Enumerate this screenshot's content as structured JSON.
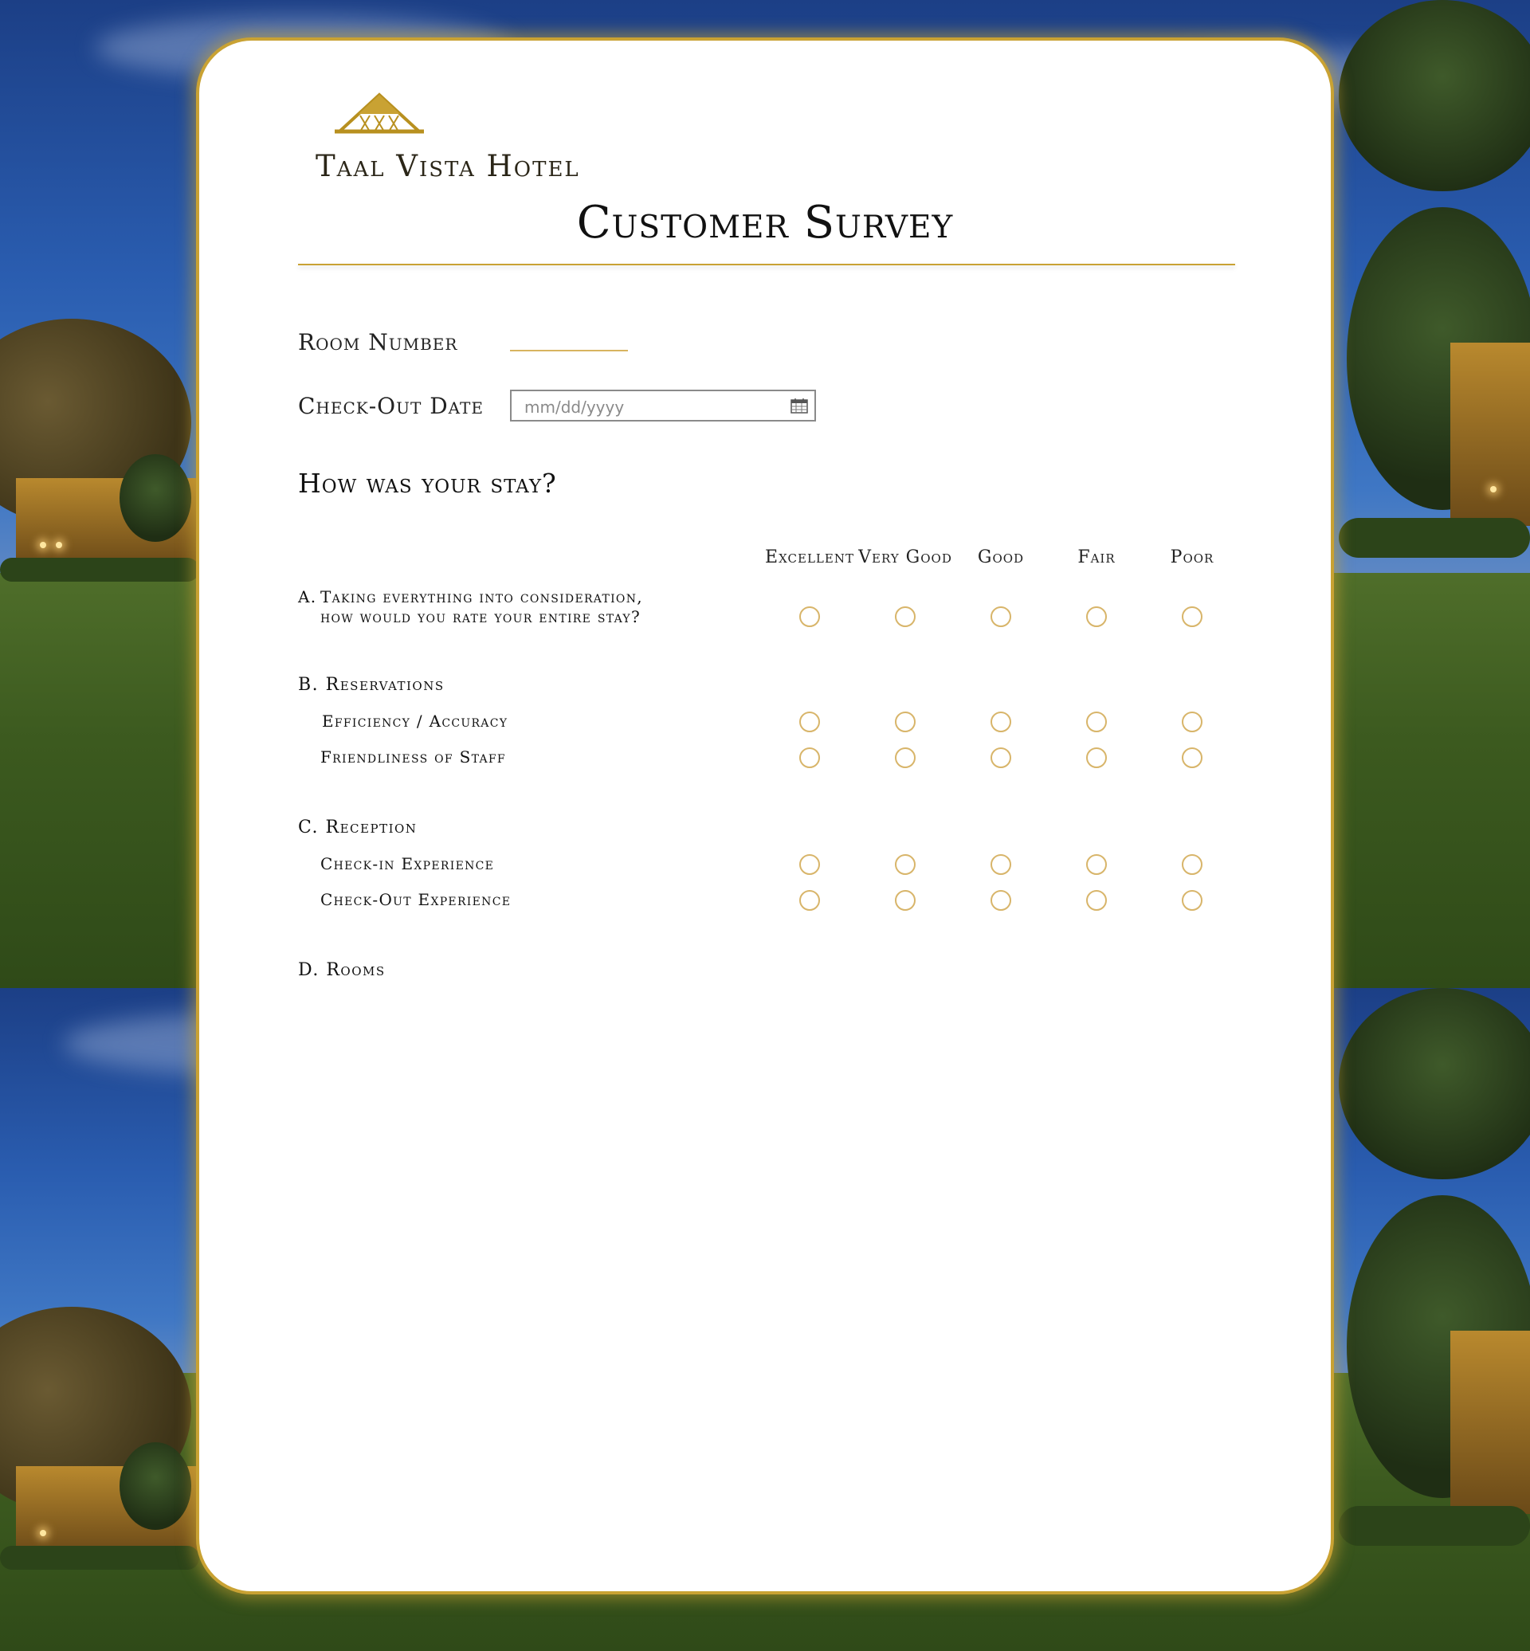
{
  "brand": {
    "name": "Taal Vista Hotel",
    "accent_color": "#c9a233"
  },
  "form": {
    "title": "Customer Survey",
    "room_number": {
      "label": "Room Number",
      "value": ""
    },
    "checkout_date": {
      "label": "Check-Out Date",
      "placeholder": "mm/dd/yyyy",
      "icon": "calendar-icon"
    },
    "section_title": "How was your stay?",
    "columns": [
      {
        "label": "Excellent"
      },
      {
        "label": "Very Good"
      },
      {
        "label": "Good"
      },
      {
        "label": "Fair"
      },
      {
        "label": "Poor"
      }
    ],
    "questions": {
      "a": {
        "marker": "A.",
        "line1": "Taking everything into consideration,",
        "line2": "how would you rate your entire stay?"
      },
      "b": {
        "title": "B.  Reservations",
        "items": [
          "Efficiency / Accuracy",
          "Friendliness of Staff"
        ]
      },
      "c": {
        "title": "C.  Reception",
        "items": [
          "Check-in Experience",
          "Check-Out Experience"
        ]
      },
      "d": {
        "title": "D.  Rooms"
      }
    }
  }
}
